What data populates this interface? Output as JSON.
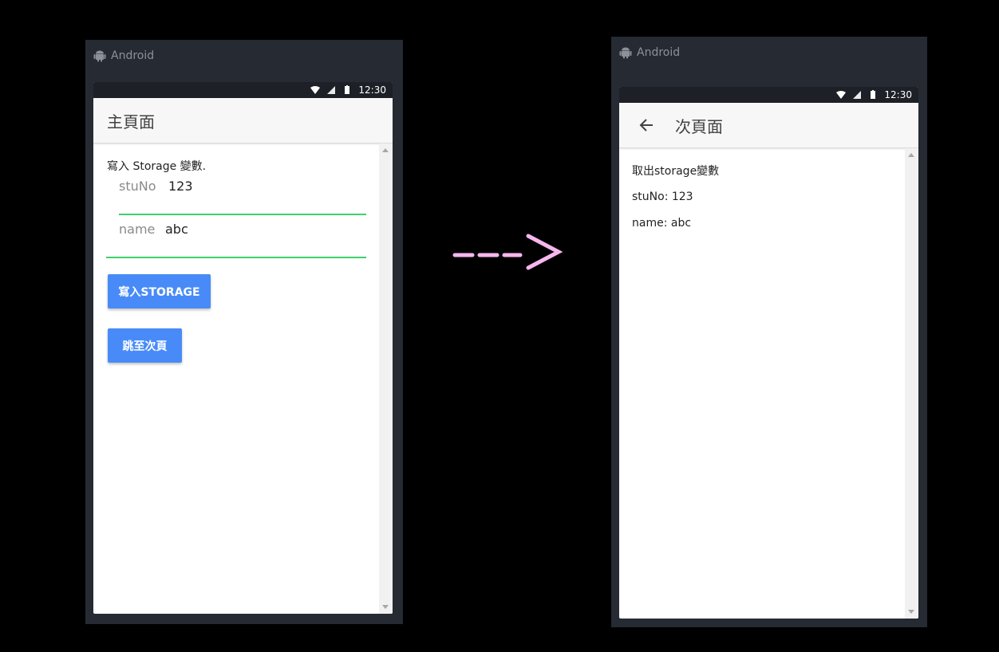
{
  "left_device": {
    "platform_label": "Android",
    "status_time": "12:30",
    "toolbar_title": "主頁面",
    "intro_text": "寫入 Storage 變數.",
    "fields": {
      "stuno_label": "stuNo",
      "stuno_value": "123",
      "name_label": "name",
      "name_value": "abc"
    },
    "buttons": {
      "write_label": "寫入STORAGE",
      "next_label": "跳至次頁"
    }
  },
  "right_device": {
    "platform_label": "Android",
    "status_time": "12:30",
    "toolbar_title": "次頁面",
    "title_line": "取出storage變數",
    "stuno_line": "stuNo: 123",
    "name_line": "name: abc"
  },
  "colors": {
    "frame": "#262a33",
    "accent_button": "#488bf8",
    "field_underline": "#3ed06b",
    "arrow": "#f7b6ee"
  },
  "icons": [
    "android-icon",
    "wifi-icon",
    "signal-icon",
    "battery-icon",
    "back-arrow-icon"
  ]
}
